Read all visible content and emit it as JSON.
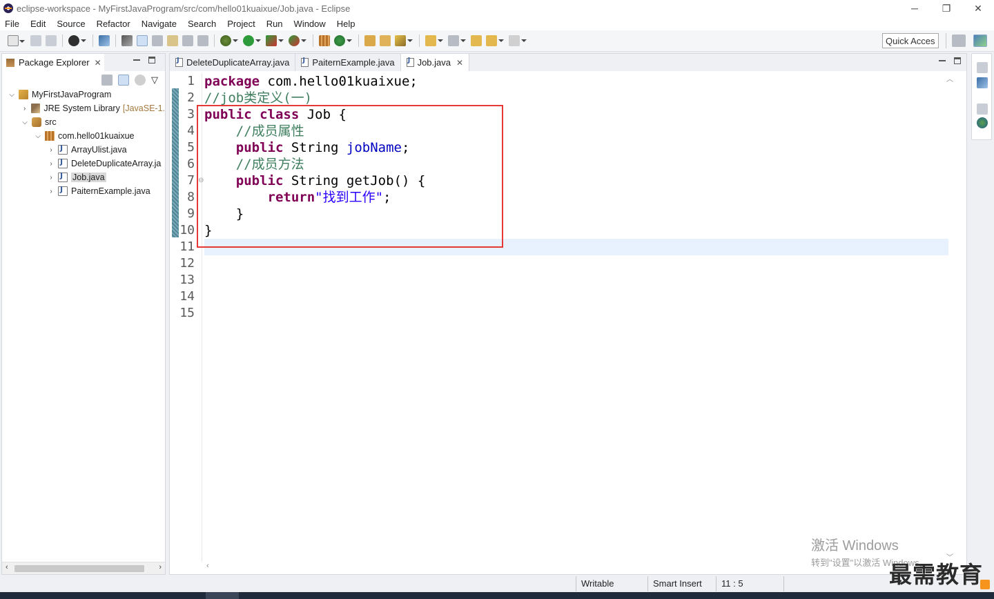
{
  "window": {
    "title": "eclipse-workspace - MyFirstJavaProgram/src/com/hello01kuaixue/Job.java - Eclipse",
    "controls": {
      "minimize": "─",
      "restore": "❐",
      "close": "✕"
    }
  },
  "menu": [
    "File",
    "Edit",
    "Source",
    "Refactor",
    "Navigate",
    "Search",
    "Project",
    "Run",
    "Window",
    "Help"
  ],
  "toolbar": {
    "quick_access": "Quick Access",
    "icons": [
      "new-icon",
      "save-icon",
      "save-all-icon",
      "account-icon",
      "skip-breakpoints-icon",
      "new-java-project-icon",
      "mark-occurrences-icon",
      "toggle-block-icon",
      "show-whitespace-icon",
      "debug-icon",
      "run-icon",
      "coverage-icon",
      "external-tools-icon",
      "new-package-icon",
      "new-class-icon",
      "open-type-icon",
      "open-task-icon",
      "search-icon",
      "next-annotation-icon",
      "prev-annotation-icon",
      "last-edit-icon",
      "back-icon",
      "forward-icon"
    ]
  },
  "package_explorer": {
    "tab_label": "Package Explorer",
    "tree": [
      {
        "label": "MyFirstJavaProgram",
        "level": 0,
        "twisty": "⌵",
        "icon": "project-icon"
      },
      {
        "label": "JRE System Library",
        "extra": "[JavaSE-1.",
        "level": 1,
        "twisty": "›",
        "icon": "library-icon"
      },
      {
        "label": "src",
        "level": 1,
        "twisty": "⌵",
        "icon": "source-folder-icon"
      },
      {
        "label": "com.hello01kuaixue",
        "level": 2,
        "twisty": "⌵",
        "icon": "package-icon"
      },
      {
        "label": "ArrayUlist.java",
        "level": 3,
        "twisty": "›",
        "icon": "java-file-icon"
      },
      {
        "label": "DeleteDuplicateArray.ja",
        "level": 3,
        "twisty": "›",
        "icon": "java-file-icon"
      },
      {
        "label": "Job.java",
        "level": 3,
        "twisty": "›",
        "icon": "java-file-icon",
        "selected": true
      },
      {
        "label": "PaiternExample.java",
        "level": 3,
        "twisty": "›",
        "icon": "java-file-icon"
      }
    ]
  },
  "editor": {
    "tabs": [
      {
        "label": "DeleteDuplicateArray.java",
        "active": false
      },
      {
        "label": "PaiternExample.java",
        "active": false
      },
      {
        "label": "Job.java",
        "active": true
      }
    ],
    "line_numbers": [
      "1",
      "2",
      "3",
      "4",
      "5",
      "6",
      "7",
      "8",
      "9",
      "10",
      "11",
      "12",
      "13",
      "14",
      "15"
    ],
    "code": {
      "l1_kw": "package",
      "l1_rest": " com.hello01kuaixue;",
      "l2_comment": "//job类定义(一)",
      "l3_kw1": "public",
      "l3_kw2": "class",
      "l3_rest": " Job {",
      "l4_comment": "//成员属性",
      "l5_kw": "public",
      "l5_type": " String ",
      "l5_field": "jobName",
      "l5_end": ";",
      "l6_comment": "//成员方法",
      "l7_kw": "public",
      "l7_rest": " String getJob() {",
      "l8_kw": "return",
      "l8_str": "\"找到工作\"",
      "l8_end": ";",
      "l9": "}",
      "l10": "}"
    },
    "current_line": 11
  },
  "status": {
    "writable": "Writable",
    "insert_mode": "Smart Insert",
    "position": "11 : 5"
  },
  "overlay": {
    "activate_title": "激活 Windows",
    "activate_sub": "转到\"设置\"以激活 Windows。",
    "brand": "最需教育"
  },
  "colors": {
    "keyword": "#7f0055",
    "comment": "#3f7f5f",
    "field": "#0000c0",
    "string": "#2a00ff",
    "highlight_box": "#e53935",
    "current_line": "#e8f2fe"
  }
}
